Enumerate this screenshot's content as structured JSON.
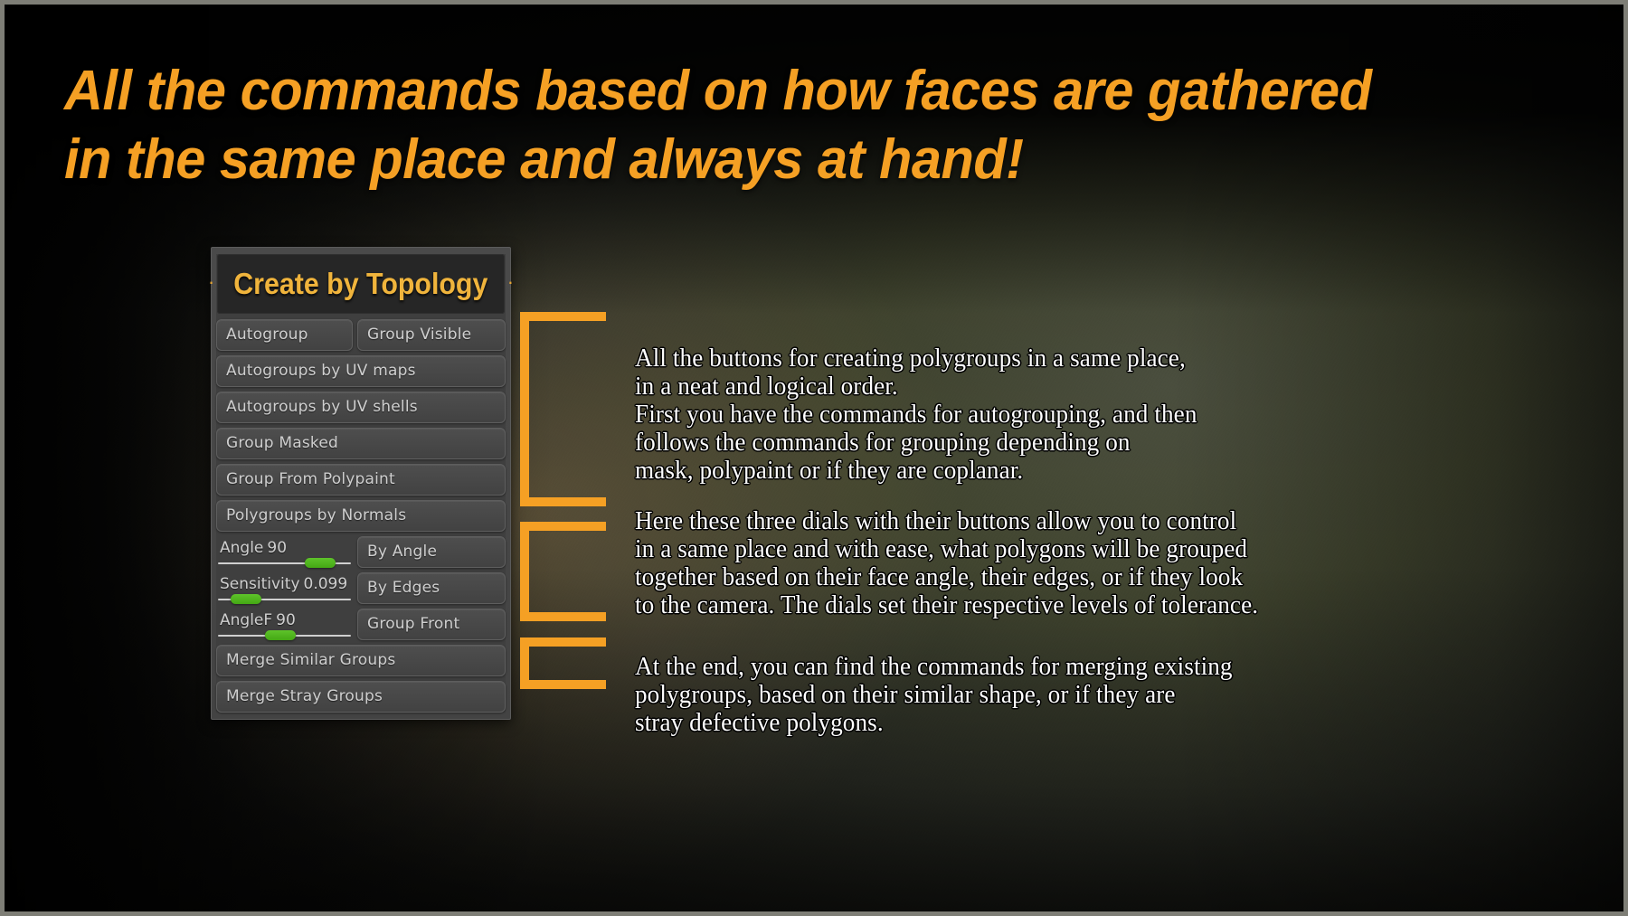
{
  "title": "All the commands based on how faces are gathered\nin the same place and always at hand!",
  "panel": {
    "header_dot_left": "·",
    "header_dot_right": "·",
    "header_title": "Create by Topology",
    "rows": [
      {
        "type": "pair",
        "left": "Autogroup",
        "right": "Group Visible"
      },
      {
        "type": "full",
        "label": "Autogroups by UV maps"
      },
      {
        "type": "full",
        "label": "Autogroups by UV shells"
      },
      {
        "type": "full",
        "label": "Group Masked"
      },
      {
        "type": "full",
        "label": "Group From Polypaint"
      },
      {
        "type": "full",
        "label": "Polygroups by Normals"
      }
    ],
    "sliders": [
      {
        "name": "Angle",
        "value": "90",
        "knob_percent": 84,
        "button": "By Angle"
      },
      {
        "name": "Sensitivity",
        "value": "0.099",
        "knob_percent": 14,
        "button": "By Edges"
      },
      {
        "name": "AngleF",
        "value": "90",
        "knob_percent": 46,
        "button": "Group Front"
      }
    ],
    "footer_buttons": [
      "Merge Similar Groups",
      "Merge Stray Groups"
    ]
  },
  "notes": [
    {
      "id": "note-creation",
      "text": "All the buttons for creating polygroups in a same place,\nin a neat and logical order.\nFirst you have the commands for autogrouping, and then\nfollows the commands for grouping depending on\nmask, polypaint or if they are coplanar."
    },
    {
      "id": "note-dials",
      "text": "Here these three dials with their buttons allow you to control\nin a same place and with ease, what polygons will be grouped\ntogether based on their face angle, their edges, or if they look\nto the camera. The dials set their respective levels of tolerance."
    },
    {
      "id": "note-merge",
      "text": "At the end, you can find the commands for merging existing\npolygroups, based on their similar shape, or if they are\nstray defective polygons."
    }
  ],
  "colors": {
    "accent_orange": "#F5A024",
    "panel_title_gold": "#F0B43C",
    "slider_green": "#4FB41E",
    "button_text": "#CFCFCF",
    "note_text": "#FFFFFF"
  }
}
